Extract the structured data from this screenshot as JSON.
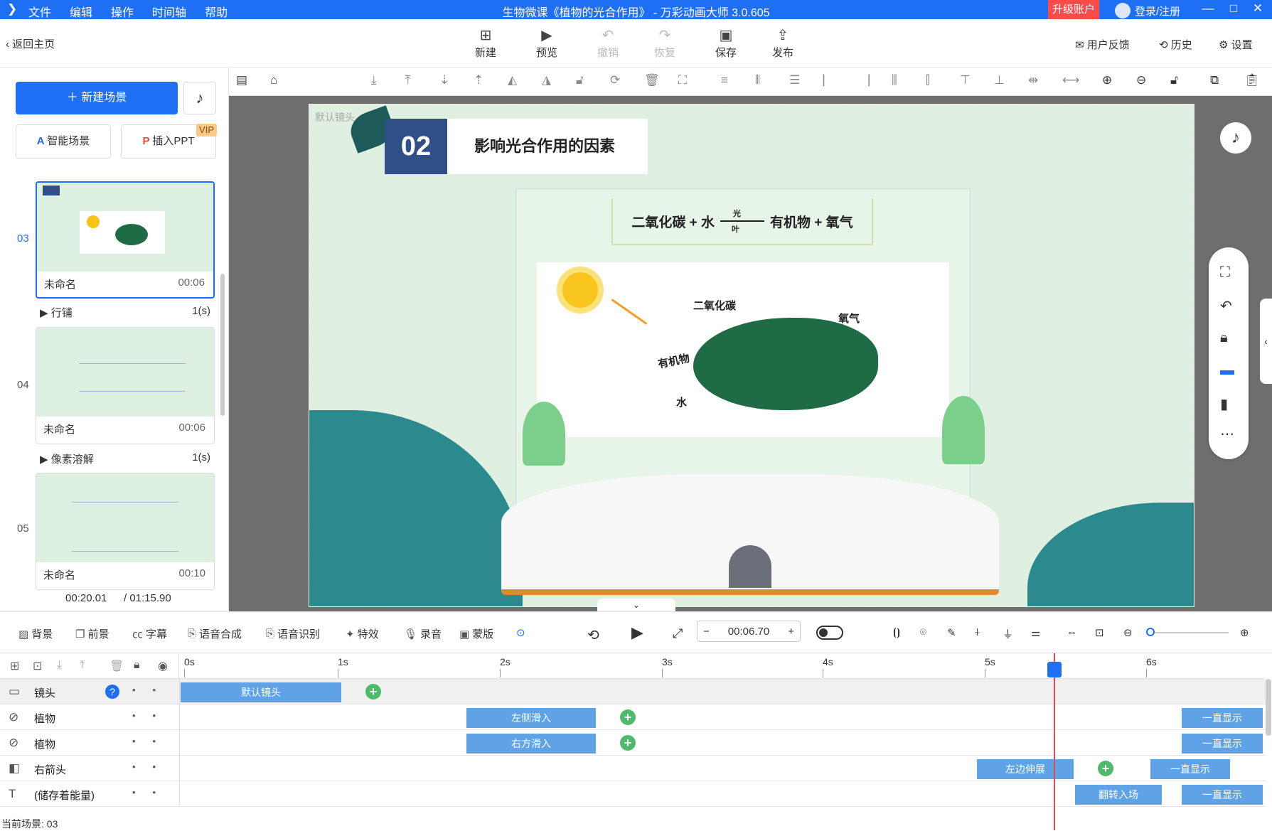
{
  "titlebar": {
    "menu": [
      "文件",
      "编辑",
      "操作",
      "时间轴",
      "帮助"
    ],
    "title": "生物微课《植物的光合作用》 - 万彩动画大师 3.0.605",
    "upgrade": "升级账户",
    "login": "登录/注册"
  },
  "toolbar": {
    "back": "返回主页",
    "new": "新建",
    "preview": "预览",
    "undo": "撤销",
    "redo": "恢复",
    "save": "保存",
    "publish": "发布",
    "feedback": "用户反馈",
    "history": "历史",
    "settings": "设置"
  },
  "left": {
    "new_scene": "新建场景",
    "smart_scene": "智能场景",
    "insert_ppt": "插入PPT",
    "vip": "VIP",
    "scenes": [
      {
        "num": "03",
        "name": "未命名",
        "duration": "00:06",
        "transition": "行铺",
        "trans_dur": "1(s)"
      },
      {
        "num": "04",
        "name": "未命名",
        "duration": "00:06",
        "transition": "像素溶解",
        "trans_dur": "1(s)"
      },
      {
        "num": "05",
        "name": "未命名",
        "duration": "00:10"
      }
    ],
    "elapsed": "00:20.01",
    "total": "/ 01:15.90"
  },
  "stage": {
    "label": "默认镜头",
    "badge": "02",
    "heading": "影响光合作用的因素",
    "equation_a": "二氧化碳 + 水",
    "equation_light": "光",
    "equation_leaf": "叶",
    "equation_b": "有机物 + 氧气",
    "co2": "二氧化碳",
    "o2": "氧气",
    "organic": "有机物",
    "water": "水"
  },
  "bottom_tools": {
    "bg": "背景",
    "fg": "前景",
    "subtitle": "字幕",
    "tts": "语音合成",
    "asr": "语音识别",
    "effect": "特效",
    "record": "录音",
    "mask": "蒙版",
    "time": "00:06.70"
  },
  "timeline": {
    "ticks": [
      "0s",
      "1s",
      "2s",
      "3s",
      "4s",
      "5s",
      "6s"
    ],
    "tracks": [
      {
        "name": "镜头",
        "clips": [
          "默认镜头"
        ]
      },
      {
        "name": "植物",
        "clips": [
          "左侧滑入",
          "一直显示"
        ]
      },
      {
        "name": "植物",
        "clips": [
          "右方滑入",
          "一直显示"
        ]
      },
      {
        "name": "右箭头",
        "clips": [
          "左边伸展",
          "一直显示"
        ]
      },
      {
        "name": "(储存着能量)",
        "clips": [
          "翻转入场",
          "一直显示"
        ]
      }
    ],
    "current_scene": "当前场景: 03"
  },
  "colors": {
    "accent": "#1f6ff5",
    "clip": "#5fa3e6",
    "keyframe": "#4dbb6a",
    "upgrade": "#ff4a4a",
    "playhead": "#e24b4b"
  }
}
